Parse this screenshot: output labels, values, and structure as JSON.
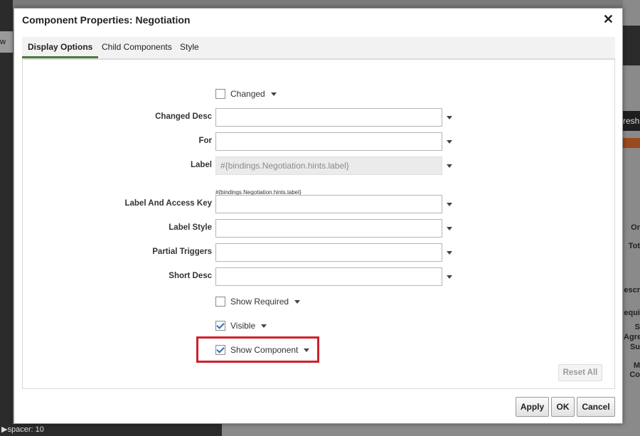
{
  "background": {
    "left_button": "w",
    "right_button": "resh",
    "right_texts": [
      "Or",
      "Tot",
      "escr",
      "equi",
      "S",
      "Agre",
      "Su",
      "M",
      "Co"
    ],
    "bottom_status": "▶spacer: 10"
  },
  "dialog": {
    "title": "Component Properties: Negotiation",
    "close": "✕"
  },
  "tabs": [
    {
      "label": "Display Options",
      "active": true
    },
    {
      "label": "Child Components",
      "active": false
    },
    {
      "label": "Style",
      "active": false
    }
  ],
  "form": {
    "changed_label": "Changed",
    "changed_desc_label": "Changed Desc",
    "changed_desc_value": "",
    "for_label": "For",
    "for_value": "",
    "label_label": "Label",
    "label_value": "#{bindings.Negotiation.hints.label}",
    "label_hint": "#{bindings.Negotiation.hints.label}",
    "label_access_key_label": "Label And Access Key",
    "label_access_key_value": "",
    "label_style_label": "Label Style",
    "label_style_value": "",
    "partial_triggers_label": "Partial Triggers",
    "partial_triggers_value": "",
    "short_desc_label": "Short Desc",
    "short_desc_value": "",
    "show_required_label": "Show Required",
    "visible_label": "Visible",
    "show_component_label": "Show Component",
    "checkboxes": {
      "changed": false,
      "show_required": false,
      "visible": true,
      "show_component": true
    }
  },
  "buttons": {
    "reset_all": "Reset All",
    "apply": "Apply",
    "ok": "OK",
    "cancel": "Cancel"
  },
  "colors": {
    "highlight": "#d0202a",
    "tab_accent": "#4a7a3a",
    "checkmark": "#2a6fb0"
  }
}
